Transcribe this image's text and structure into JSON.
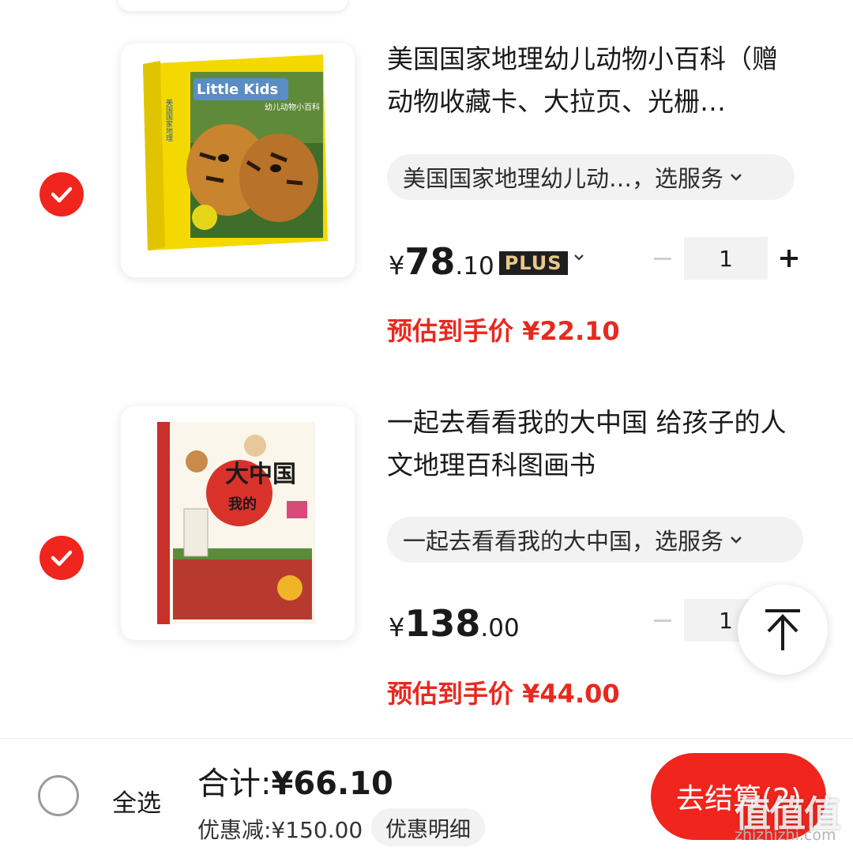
{
  "items": [
    {
      "title": "美国国家地理幼儿动物小百科（赠动物收藏卡、大拉页、光栅…",
      "spec": "美国国家地理幼儿动…，选服务",
      "price_yen": "¥",
      "price_int": "78",
      "price_dec": ".10",
      "plus_badge": "PLUS",
      "quantity": "1",
      "estimate": "预估到手价 ¥22.10",
      "cover": {
        "brand_top": "美国国家地理",
        "series": "Little Kids",
        "subtitle": "幼儿动物小百科"
      }
    },
    {
      "title": "一起去看看我的大中国 给孩子的人文地理百科图画书",
      "spec": "一起去看看我的大中国，选服务",
      "price_yen": "¥",
      "price_int": "138",
      "price_dec": ".00",
      "quantity": "1",
      "estimate": "预估到手价 ¥44.00",
      "cover": {
        "title_big": "大中国",
        "title_small": "我的"
      }
    }
  ],
  "footer": {
    "select_all": "全选",
    "total_label": "合计:",
    "total_amount": "¥66.10",
    "discount": "优惠减:¥150.00",
    "detail_button": "优惠明细",
    "checkout_button": "去结算(2)"
  },
  "watermark": {
    "logo": "值值值",
    "url": "zhizhizhi.com"
  },
  "colors": {
    "accent": "#f0251d",
    "estimate_text": "#e8291f",
    "plus_bg": "#1f1f1f",
    "plus_text": "#e9c889"
  }
}
